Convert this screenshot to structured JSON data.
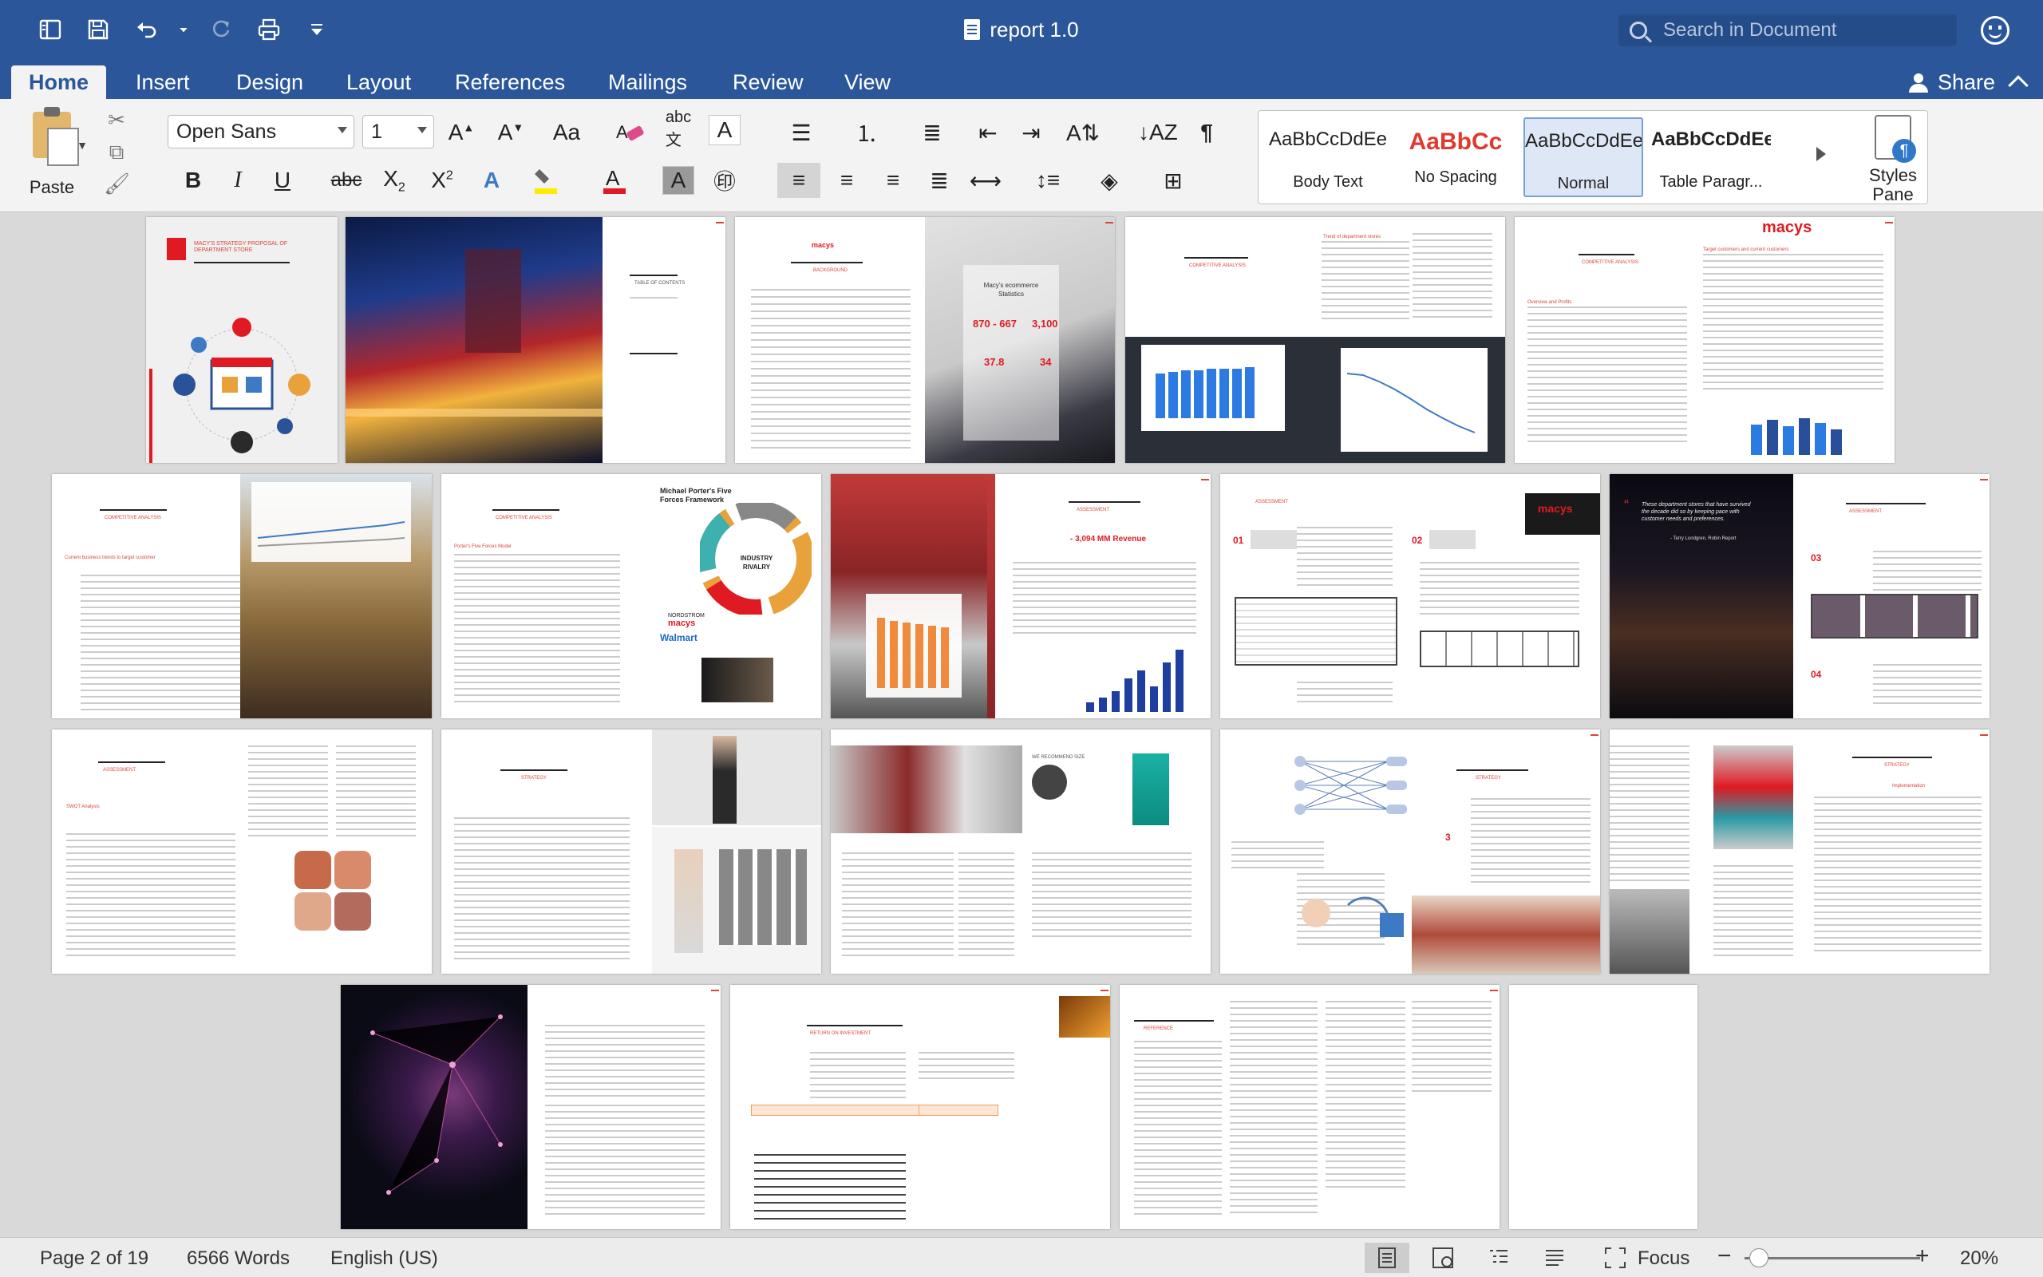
{
  "window": {
    "title": "report 1.0"
  },
  "search": {
    "placeholder": "Search in Document"
  },
  "tabs": [
    "Home",
    "Insert",
    "Design",
    "Layout",
    "References",
    "Mailings",
    "Review",
    "View"
  ],
  "active_tab": "Home",
  "share_label": "Share",
  "clipboard": {
    "paste_label": "Paste"
  },
  "font": {
    "name": "Open Sans",
    "size": "1"
  },
  "style_gallery": [
    {
      "sample": "AaBbCcDdEe",
      "name": "Body Text",
      "color": "#222222"
    },
    {
      "sample": "AaBbCc",
      "name": "No Spacing",
      "color": "#e03a2f"
    },
    {
      "sample": "AaBbCcDdEe",
      "name": "Normal",
      "color": "#222222"
    },
    {
      "sample": "AaBbCcDdEe",
      "name": "Table Paragr...",
      "color": "#222222"
    }
  ],
  "styles_pane_label": "Styles\nPane",
  "thumbnails": {
    "toc_title": "TABLE OF CONTENTS",
    "background_title": "BACKGROUND",
    "competitive_title": "COMPETITIVE ANALYSIS",
    "trend_title": "Trend of department stores",
    "target_title": "Target customers and current customers",
    "overview_title": "Overview and Profits",
    "current_business_title": "Current business trends to target customer",
    "porter_title": "Porter's Five Forces Model",
    "porter_heading": "Michael Porter's Five Forces Framework",
    "industry_rivalry": "INDUSTRY RIVALRY",
    "assessment_title": "ASSESSMENT",
    "assessment_value": "- 3,094 MM  Revenue",
    "assessment_title_2": "ASSESSMENT",
    "strategy_title": "STRATEGY",
    "implementation_title": "Implementation",
    "reference_title": "REFERENCE",
    "roi_title": "RETURN ON INVESTMENT",
    "macys_stat_caption": "Macy's ecommerce Statistics",
    "stat_values": [
      "870 - 667",
      "3,100",
      "37.8",
      "34"
    ],
    "cover_title": "MACY'S STRATEGY PROPOSAL OF DEPARTMENT STORE",
    "quote": "These department stores that have survived the decade did so by keeping pace with customer needs and preferences.",
    "quote_author": "- Terry Lundgren, Robin Report",
    "macys_logo": "macys",
    "nordstrom": "NORDSTROM",
    "walmart": "Walmart",
    "we_recommend": "WE RECOMMEND SIZE",
    "swot_title": "SWOT Analysis",
    "numbers": [
      "01",
      "02",
      "03",
      "04"
    ]
  },
  "status": {
    "page": "Page 2 of 19",
    "words": "6566 Words",
    "language": "English (US)",
    "focus_label": "Focus",
    "zoom": "20%"
  },
  "colors": {
    "word_blue": "#2b579a",
    "accent_red": "#d9453a",
    "macys_red": "#e01a22"
  }
}
